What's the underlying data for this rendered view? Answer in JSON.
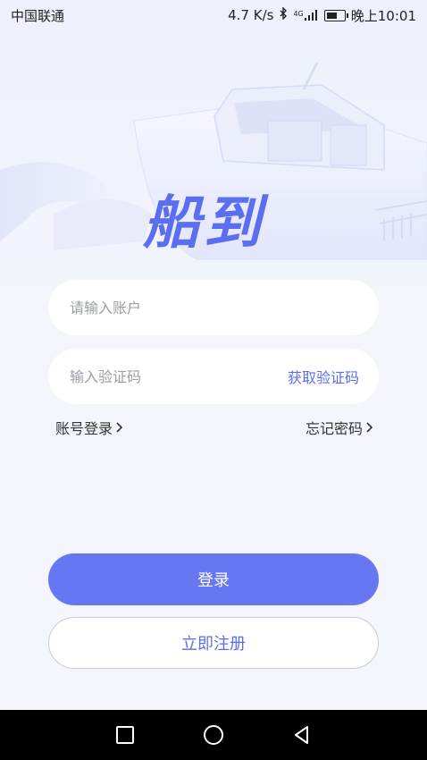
{
  "status_bar": {
    "carrier": "中国联通",
    "speed": "4.7 K/s",
    "network": "4G",
    "time": "晚上10:01",
    "battery_level": 0.7
  },
  "brand": {
    "logo_text": "船到",
    "accent_color": "#5b6ef0"
  },
  "form": {
    "account_placeholder": "请输入账户",
    "code_placeholder": "输入验证码",
    "get_code_label": "获取验证码"
  },
  "links": {
    "account_login": "账号登录",
    "forgot_password": "忘记密码"
  },
  "buttons": {
    "login": "登录",
    "register": "立即注册"
  },
  "nav_icons": [
    "square-icon",
    "circle-icon",
    "triangle-back-icon"
  ]
}
